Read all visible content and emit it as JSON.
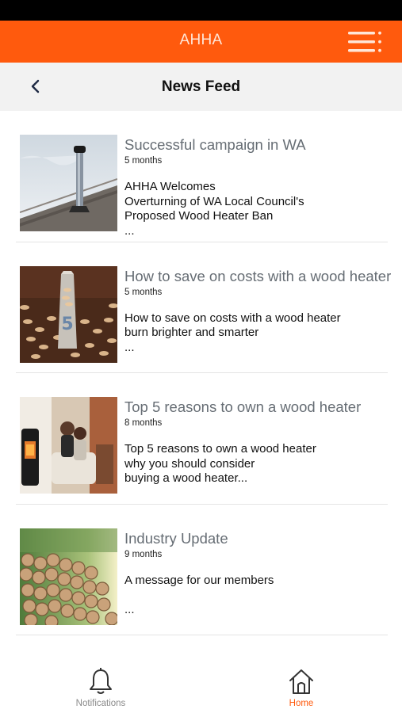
{
  "app": {
    "title": "AHHA",
    "accent": "#ff5a0d"
  },
  "header": {
    "title": "News Feed",
    "back_icon": "chevron-left-icon",
    "menu_icon": "menu-icon"
  },
  "feed": {
    "items": [
      {
        "title": "Successful campaign in WA",
        "age": "5 months",
        "body": "AHHA Welcomes\nOverturning of WA Local Council's\nProposed Wood Heater Ban\n...",
        "image": "chimney-on-roof"
      },
      {
        "title": "How to save on costs with a wood heater",
        "age": "5 months",
        "body": "How to save on costs with a wood heater\nburn brighter and smarter\n...",
        "image": "wood-pellets"
      },
      {
        "title": "Top 5 reasons to own a wood heater",
        "age": "8 months",
        "body": "Top 5 reasons to own a wood heater\n                           why you should consider\nbuying a wood heater...",
        "image": "family-by-fireplace"
      },
      {
        "title": "Industry Update",
        "age": "9 months",
        "body": "A message for our members\n\n                                       ...",
        "image": "stacked-logs"
      }
    ]
  },
  "bottom_nav": {
    "notifications": {
      "label": "Notifications",
      "icon": "bell-icon"
    },
    "home": {
      "label": "Home",
      "icon": "home-icon",
      "active": true
    }
  }
}
